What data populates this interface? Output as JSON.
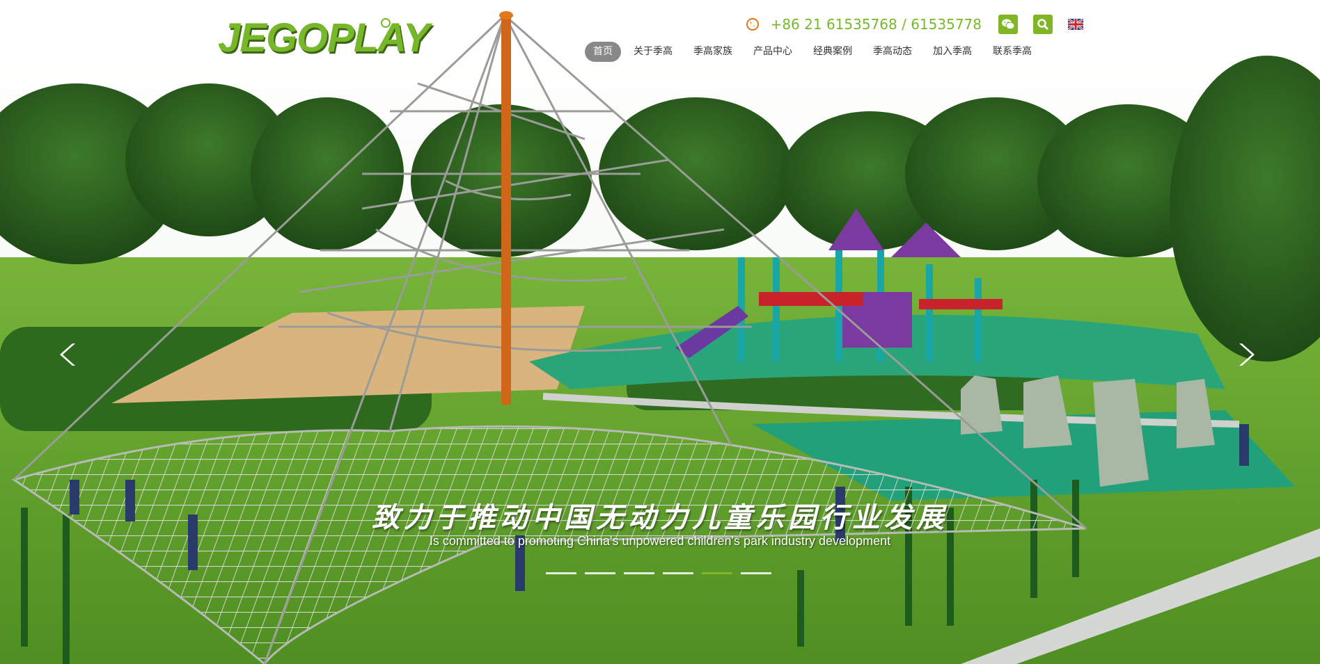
{
  "brand": {
    "logo_text": "JEGOPLAY",
    "accent": "#7fb626"
  },
  "contact": {
    "phone": "+86 21 61535768 / 61535778",
    "phone_icon": "phone-icon"
  },
  "topbar": {
    "wechat_icon": "wechat-icon",
    "search_icon": "search-icon",
    "language_flag": "uk-flag-icon"
  },
  "nav": {
    "items": [
      {
        "label": "首页",
        "active": true
      },
      {
        "label": "关于季高"
      },
      {
        "label": "季高家族"
      },
      {
        "label": "产品中心"
      },
      {
        "label": "经典案例"
      },
      {
        "label": "季高动态"
      },
      {
        "label": "加入季高"
      },
      {
        "label": "联系季高"
      }
    ]
  },
  "hero": {
    "slogan_cn": "致力于推动中国无动力儿童乐园行业发展",
    "slogan_en": "Is committed to promoting China's unpowered children's park industry development",
    "slide_count": 6,
    "active_slide": 5
  }
}
